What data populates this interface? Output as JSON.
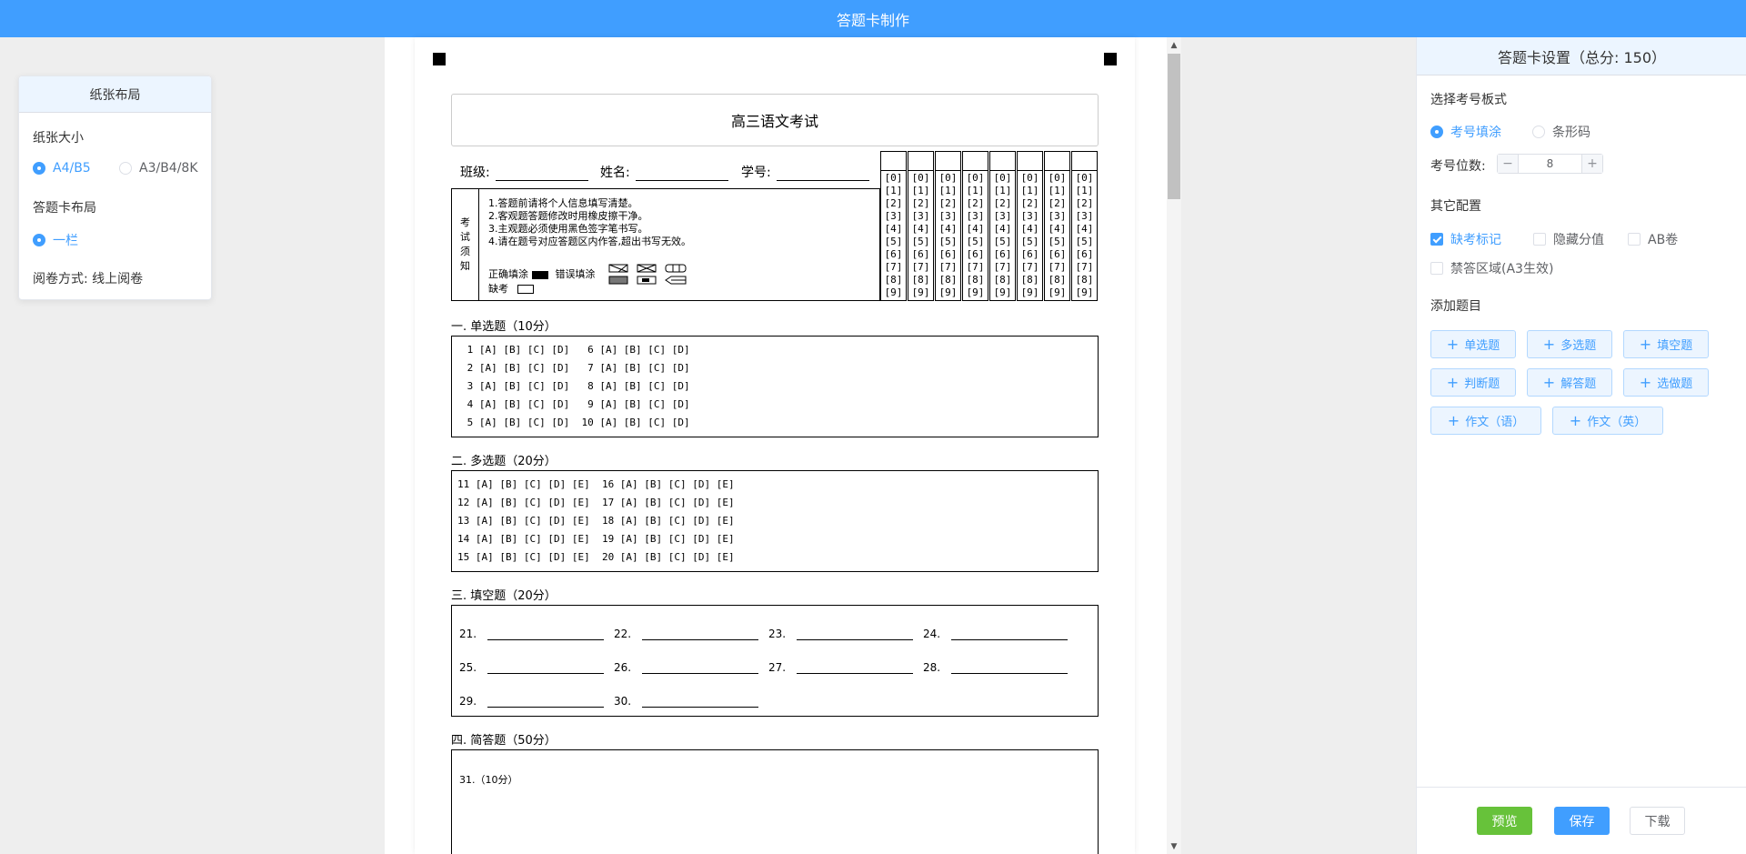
{
  "app": {
    "title": "答题卡制作"
  },
  "left_panel": {
    "title": "纸张布局",
    "paper_size_label": "纸张大小",
    "paper_options": [
      "A4/B5",
      "A3/B4/8K"
    ],
    "paper_selected": "A4/B5",
    "layout_label": "答题卡布局",
    "layout_option": "一栏",
    "review_mode": "阅卷方式: 线上阅卷"
  },
  "sheet": {
    "title": "高三语文考试",
    "info_fields": [
      "班级:",
      "姓名:",
      "学号:"
    ],
    "notice_side": [
      "考",
      "试",
      "须",
      "知"
    ],
    "notice_lines": [
      "1.答题前请将个人信息填写清楚。",
      "2.客观题答题修改时用橡皮擦干净。",
      "3.主观题必须使用黑色签字笔书写。",
      "4.请在题号对应答题区内作答,超出书写无效。"
    ],
    "correct_fill": "正确填涂",
    "wrong_fill": "错误填涂",
    "missing": "缺考",
    "id_digits": [
      "[0]",
      "[1]",
      "[2]",
      "[3]",
      "[4]",
      "[5]",
      "[6]",
      "[7]",
      "[8]",
      "[9]"
    ],
    "sections": [
      {
        "title": "一. 单选题（10分）",
        "lines": [
          " 1 [A] [B] [C] [D]   6 [A] [B] [C] [D]",
          " 2 [A] [B] [C] [D]   7 [A] [B] [C] [D]",
          " 3 [A] [B] [C] [D]   8 [A] [B] [C] [D]",
          " 4 [A] [B] [C] [D]   9 [A] [B] [C] [D]",
          " 5 [A] [B] [C] [D]  10 [A] [B] [C] [D]"
        ]
      },
      {
        "title": "二. 多选题（20分）",
        "lines": [
          "11 [A] [B] [C] [D] [E]  16 [A] [B] [C] [D] [E]",
          "12 [A] [B] [C] [D] [E]  17 [A] [B] [C] [D] [E]",
          "13 [A] [B] [C] [D] [E]  18 [A] [B] [C] [D] [E]",
          "14 [A] [B] [C] [D] [E]  19 [A] [B] [C] [D] [E]",
          "15 [A] [B] [C] [D] [E]  20 [A] [B] [C] [D] [E]"
        ]
      },
      {
        "title": "三. 填空题（20分）",
        "blanks": [
          "21.",
          "22.",
          "23.",
          "24.",
          "25.",
          "26.",
          "27.",
          "28.",
          "29.",
          "30."
        ]
      },
      {
        "title": "四. 简答题（50分）",
        "question": "31.（10分）"
      }
    ]
  },
  "right_panel": {
    "title": "答题卡设置（总分:   150）",
    "id_type_label": "选择考号板式",
    "id_type_options": [
      "考号填涂",
      "条形码"
    ],
    "id_type_selected": "考号填涂",
    "id_digits_label": "考号位数:",
    "id_digits_value": "8",
    "other_label": "其它配置",
    "checks": [
      {
        "label": "缺考标记",
        "checked": true
      },
      {
        "label": "隐藏分值",
        "checked": false
      },
      {
        "label": "AB卷",
        "checked": false
      },
      {
        "label": "禁答区域(A3生效)",
        "checked": false
      }
    ],
    "add_label": "添加题目",
    "add_buttons": [
      "单选题",
      "多选题",
      "填空题",
      "判断题",
      "解答题",
      "选做题",
      "作文（语）",
      "作文（英）"
    ],
    "footer": {
      "preview": "预览",
      "save": "保存",
      "download": "下载"
    }
  },
  "colors": {
    "primary": "#409eff",
    "success": "#67c23a"
  },
  "icons": {
    "plus": "plus-icon",
    "scroll_up": "chevron-up-icon",
    "scroll_down": "chevron-down-icon"
  }
}
